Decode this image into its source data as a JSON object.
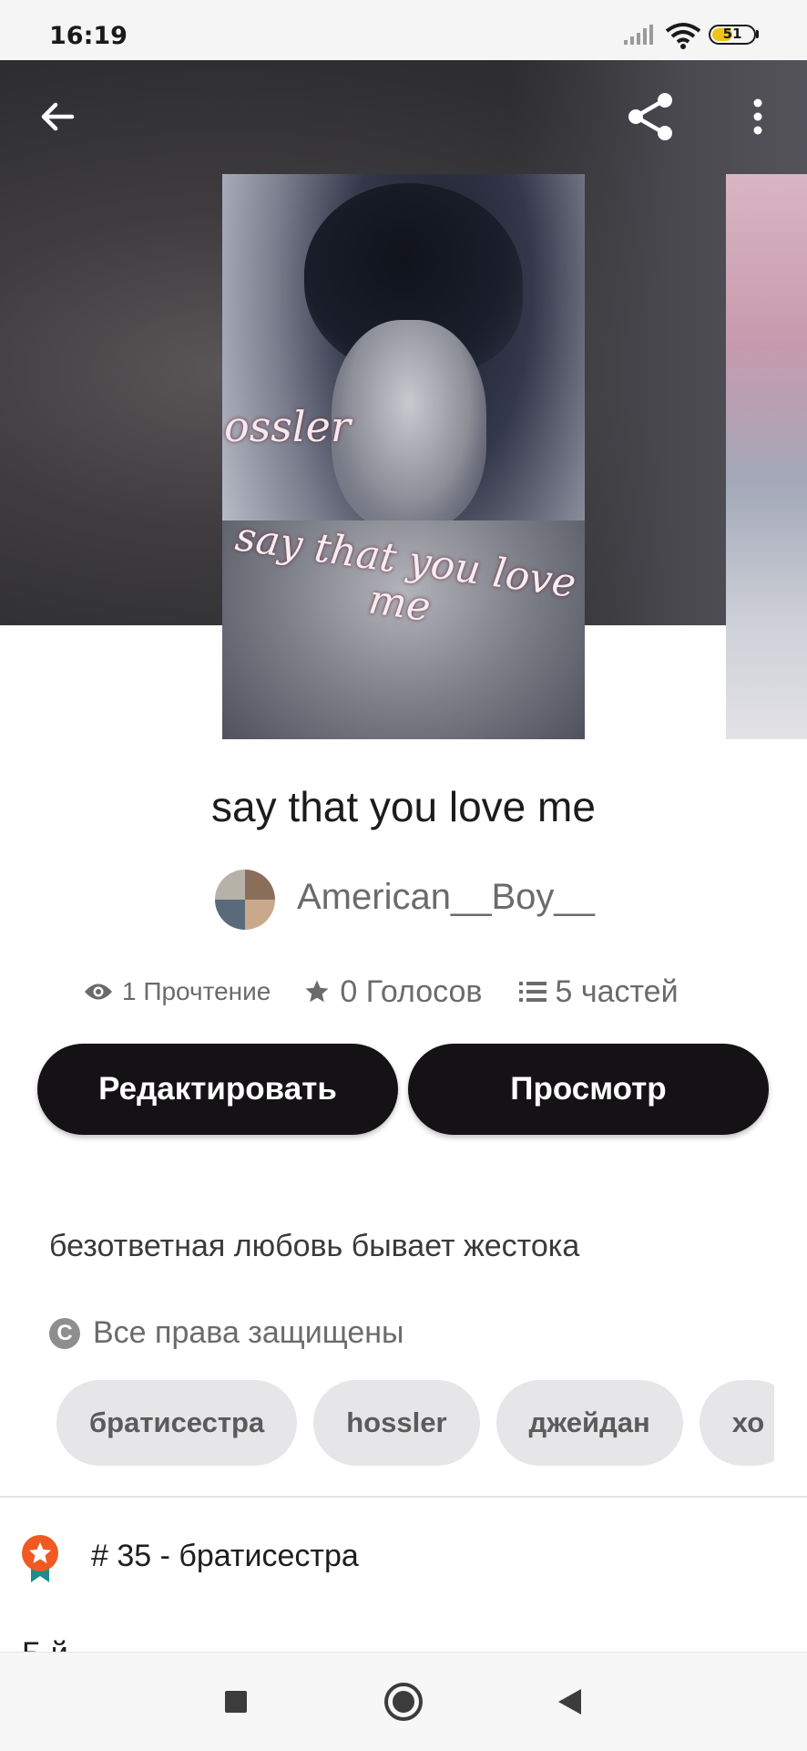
{
  "status_bar": {
    "time": "16:19",
    "battery": "51",
    "battery_fraction": 0.51
  },
  "toolbar": {
    "back_icon": "arrow-left-icon",
    "share_icon": "share-icon",
    "menu_icon": "more-vert-icon"
  },
  "cover": {
    "script_top": "ossler",
    "script_bottom": "say that you love me"
  },
  "story": {
    "title": "say that you love me",
    "author": "American__Boy__",
    "stats": {
      "reads": "1 Прочтение",
      "votes": "0 Голосов",
      "parts": "5 частей"
    },
    "buttons": {
      "edit": "Редактировать",
      "view": "Просмотр"
    },
    "description": "безответная любовь бывает жестока",
    "rights": "Все права защищены",
    "tags": [
      "братисестра",
      "hossler",
      "джейдан",
      "хо"
    ],
    "rank": "# 35 - братисестра",
    "cut_text": "Б        й"
  },
  "colors": {
    "primary_button": "#141214",
    "tag_bg": "#e6e5e8",
    "rank_badge": "#f05a22",
    "rank_ribbon": "#1d8c8c"
  }
}
